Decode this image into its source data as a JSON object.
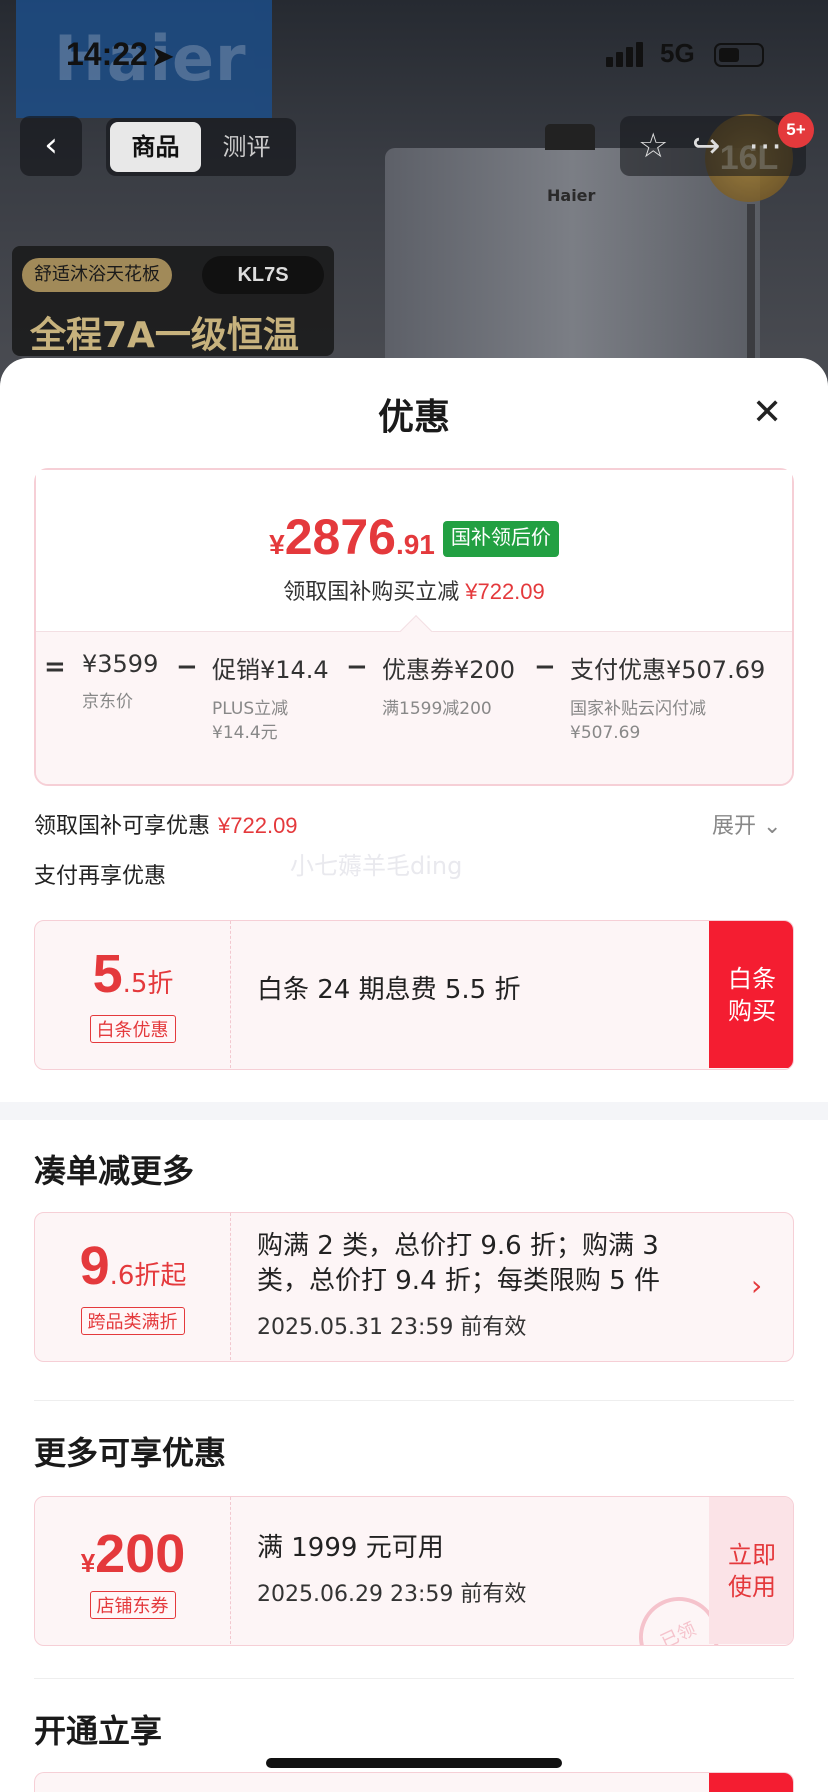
{
  "status": {
    "time": "14:22",
    "network": "5G"
  },
  "background": {
    "logo": "Haier",
    "heater_brand": "Haier",
    "badge_count": "5+",
    "capacity_badge": "16L",
    "feature_pill": "舒适沐浴天花板",
    "model_pill": "KL7S",
    "headline": "全程7A一级恒温"
  },
  "nav": {
    "back_icon": "chevron-left-icon",
    "tabs": [
      {
        "label": "商品",
        "active": true
      },
      {
        "label": "测评",
        "active": false
      }
    ],
    "actions": [
      "star-icon",
      "share-icon",
      "more-icon"
    ]
  },
  "sheet": {
    "title": "优惠",
    "close_icon": "close-icon"
  },
  "price": {
    "currency": "¥",
    "integer": "2876",
    "decimal": ".91",
    "tag": "国补领后价",
    "sub_label": "领取国补购买立减",
    "sub_value": "¥722.09",
    "breakdown": [
      {
        "op": "=",
        "value": "¥3599",
        "desc": "京东价"
      },
      {
        "op": "−",
        "value": "促销¥14.4",
        "desc": "PLUS立减\n¥14.4元"
      },
      {
        "op": "−",
        "value": "优惠券¥200",
        "desc": "满1599减200"
      },
      {
        "op": "−",
        "value": "支付优惠¥507.69",
        "desc": "国家补贴云闪付减\n¥507.69"
      }
    ]
  },
  "subsidy_row": {
    "label": "领取国补可享优惠",
    "value": "¥722.09",
    "expand": "展开"
  },
  "pay_more": {
    "label": "支付再享优惠"
  },
  "watermark": "小七薅羊毛ding",
  "baitiao": {
    "big": "5",
    "small": ".5折",
    "label": "白条优惠",
    "text": "白条 24 期息费 5.5 折",
    "action": "白条\n购买"
  },
  "section_more": {
    "title": "凑单减更多",
    "coupon": {
      "big": "9",
      "small": ".6折起",
      "label": "跨品类满折",
      "text": "购满 2 类，总价打 9.6 折；购满 3 类，总价打 9.4 折；每类限购 5 件",
      "date": "2025.05.31 23:59 前有效"
    }
  },
  "section_extra": {
    "title": "更多可享优惠",
    "coupon": {
      "currency": "¥",
      "big": "200",
      "label": "店铺东券",
      "text": "满 1999 元可用",
      "date": "2025.06.29 23:59 前有效",
      "action": "立即\n使用",
      "stamp": "已领"
    }
  },
  "section_open": {
    "title": "开通立享"
  },
  "colors": {
    "accent": "#e4393c",
    "green_tag": "#22a042",
    "buy_red": "#f41d31"
  }
}
